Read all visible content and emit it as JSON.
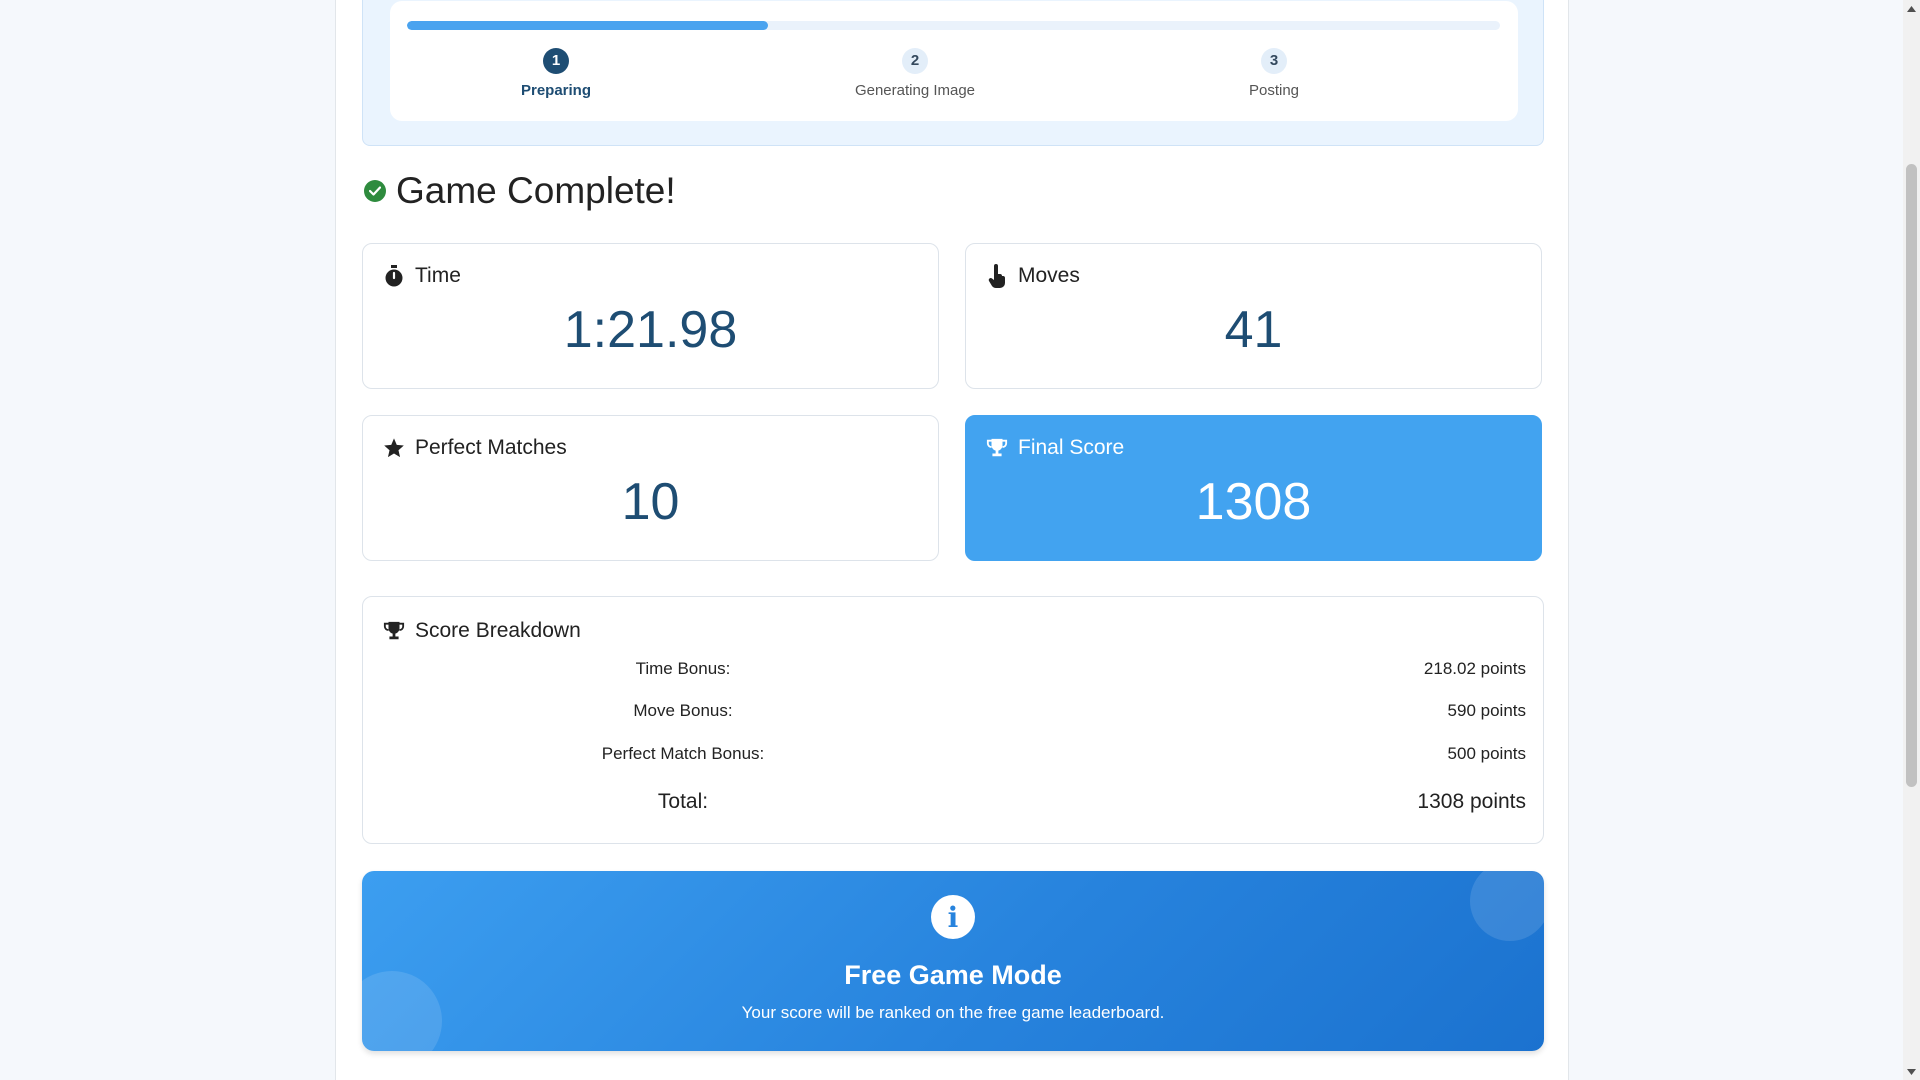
{
  "progress": {
    "fill_fraction": 0.33,
    "steps": [
      {
        "number": "1",
        "label": "Preparing",
        "active": true
      },
      {
        "number": "2",
        "label": "Generating Image",
        "active": false
      },
      {
        "number": "3",
        "label": "Posting",
        "active": false
      }
    ]
  },
  "heading": {
    "title": "Game Complete!",
    "icon": "check-circle-icon",
    "icon_color": "#2e8b3e"
  },
  "stats": {
    "time": {
      "label": "Time",
      "value": "1:21.98",
      "icon": "stopwatch-icon"
    },
    "moves": {
      "label": "Moves",
      "value": "41",
      "icon": "pointer-hand-icon"
    },
    "perfect": {
      "label": "Perfect Matches",
      "value": "10",
      "icon": "star-icon"
    },
    "final": {
      "label": "Final Score",
      "value": "1308",
      "icon": "trophy-icon",
      "color": "#42a3f0"
    }
  },
  "breakdown": {
    "title": "Score Breakdown",
    "icon": "trophy-icon",
    "rows": [
      {
        "label": "Time Bonus:",
        "value": "218.02 points"
      },
      {
        "label": "Move Bonus:",
        "value": "590 points"
      },
      {
        "label": "Perfect Match Bonus:",
        "value": "500 points"
      }
    ],
    "total": {
      "label": "Total:",
      "value": "1308 points"
    }
  },
  "banner": {
    "icon": "info-icon",
    "title": "Free Game Mode",
    "text": "Your score will be ranked on the free game leaderboard."
  },
  "colors": {
    "accent": "#42a3f0",
    "dark_blue": "#1e4d73"
  }
}
